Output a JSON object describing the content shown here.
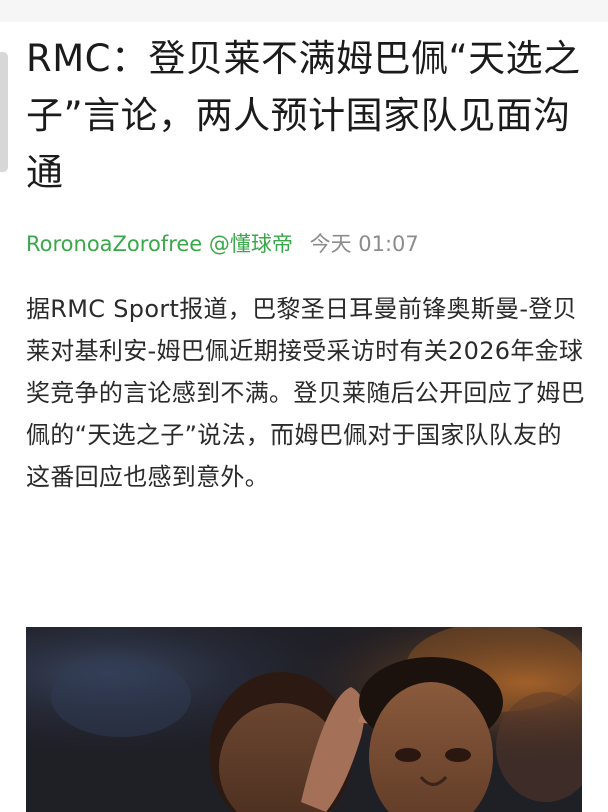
{
  "article": {
    "title": "RMC：登贝莱不满姆巴佩“天选之子”言论，两人预计国家队见面沟通",
    "author": "RoronoaZorofree @懂球帝",
    "time": "今天 01:07",
    "body": "据RMC Sport报道，巴黎圣日耳曼前锋奥斯曼-登贝莱对基利安-姆巴佩近期接受采访时有关2026年金球奖竞争的言论感到不满。登贝莱随后公开回应了姆巴佩的“天选之子”说法，而姆巴佩对于国家队队友的这番回应也感到意外。"
  },
  "colors": {
    "author": "#3aa84a",
    "time": "#8c8c8c",
    "title": "#1b1b1b",
    "body": "#2b2b2b"
  }
}
